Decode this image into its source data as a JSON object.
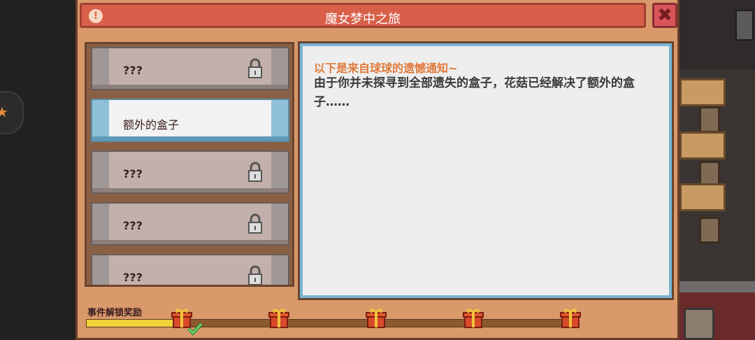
{
  "window": {
    "title": "魔女梦中之旅",
    "info_icon": "!",
    "close_icon": "✖"
  },
  "list": {
    "items": [
      {
        "label": "???",
        "locked": true,
        "active": false
      },
      {
        "label": "额外的盒子",
        "locked": false,
        "active": true
      },
      {
        "label": "???",
        "locked": true,
        "active": false
      },
      {
        "label": "???",
        "locked": true,
        "active": false
      },
      {
        "label": "???",
        "locked": true,
        "active": false
      }
    ]
  },
  "content": {
    "title": "以下是来自球球的遗憾通知~",
    "body": "由于你并未探寻到全部遗失的盒子，花菇已经解决了额外的盒子……"
  },
  "rewards": {
    "label": "事件解锁奖励",
    "progress": 0.2,
    "gifts": [
      {
        "icon": "gift-icon",
        "claimed": true
      },
      {
        "icon": "gift-icon",
        "claimed": false
      },
      {
        "icon": "gift-icon",
        "claimed": false
      },
      {
        "icon": "gift-icon",
        "claimed": false
      },
      {
        "icon": "gift-icon",
        "claimed": false
      }
    ]
  },
  "colors": {
    "accent_orange": "#e07a3a",
    "title_red": "#d95f4a",
    "active_blue": "#78b6d4"
  }
}
